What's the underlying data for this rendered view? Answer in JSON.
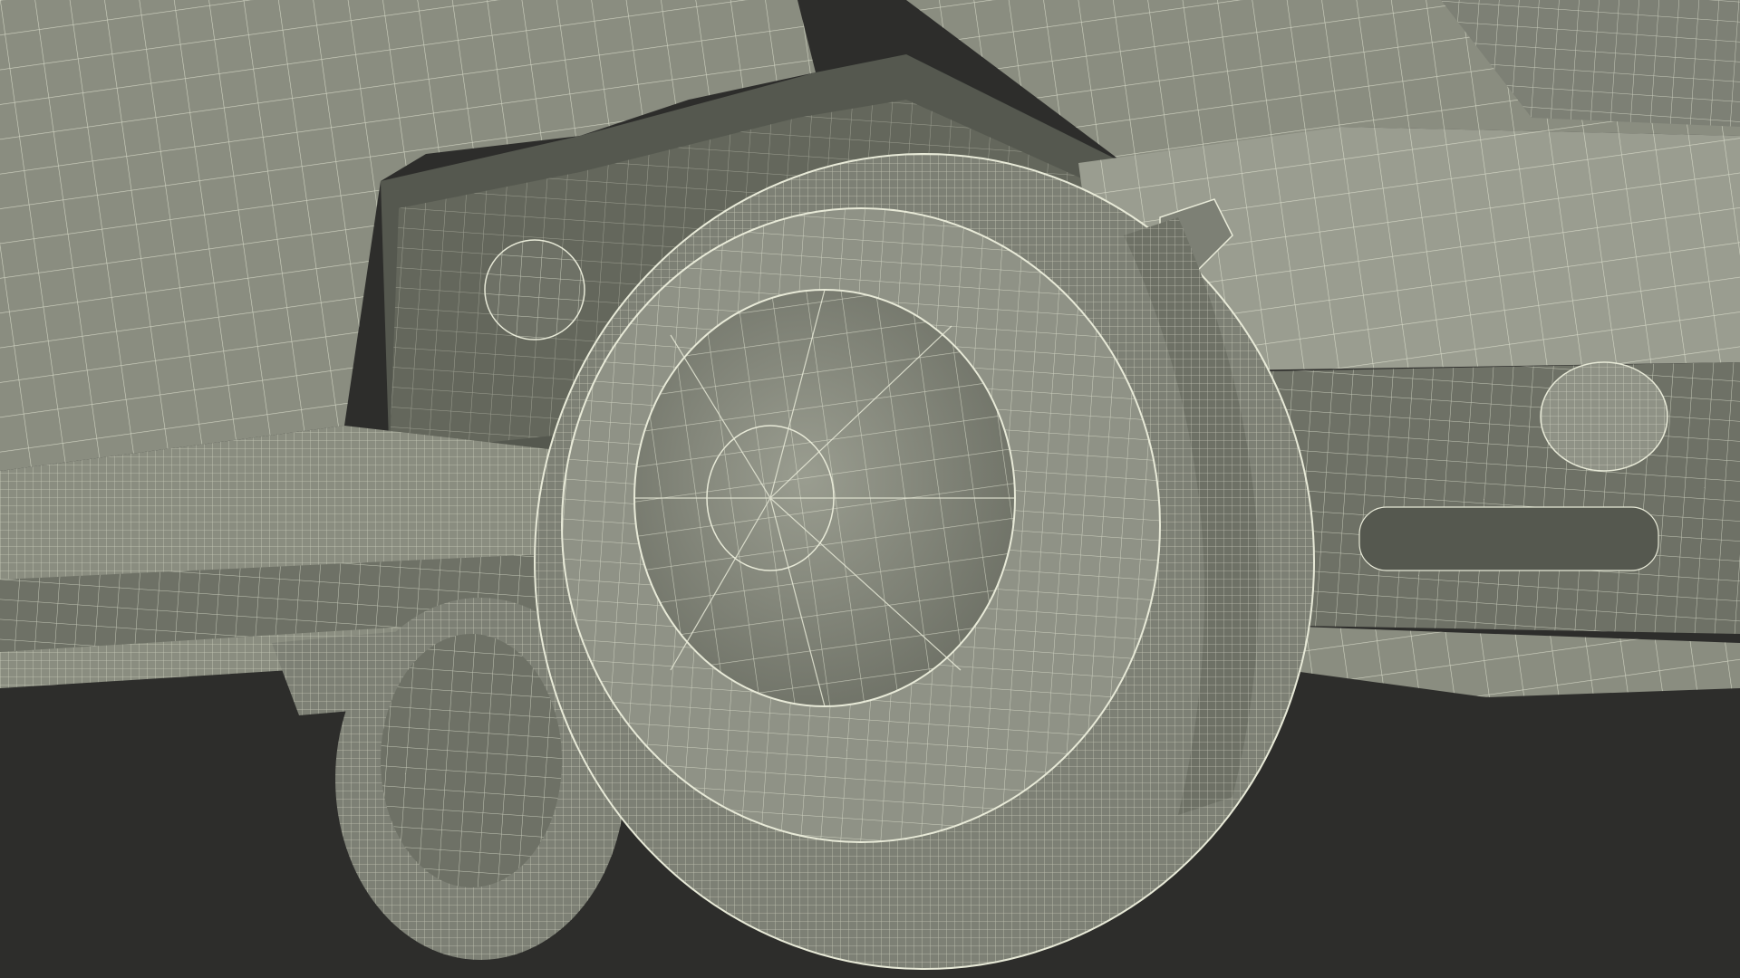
{
  "scene": {
    "subject": "wireframe-render-undercarriage-wheel",
    "colors": {
      "background": "#2d2d2b",
      "body": "#8a8d80",
      "body_light": "#9a9d90",
      "body_dark": "#6e7166",
      "shadow": "#55584f",
      "wire": "#e8ead8",
      "tire": "#7d8075",
      "hub": "#8f9286"
    }
  }
}
